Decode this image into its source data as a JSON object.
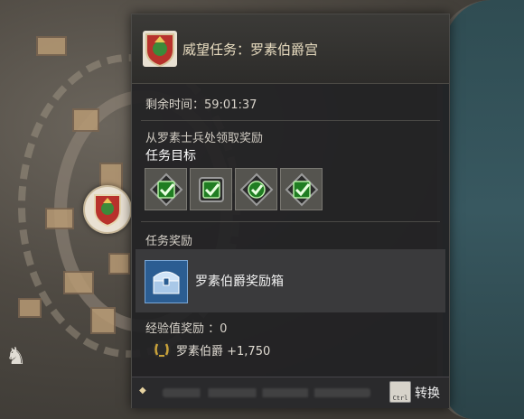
{
  "quest": {
    "title": "威望任务：罗素伯爵宫",
    "remaining_time": "剩余时间：59:01:37",
    "description": "从罗素士兵处领取奖励",
    "objective_label": "任务目标",
    "objectives_completed": 4,
    "reward_label": "任务奖励",
    "reward_item": "罗素伯爵奖励箱",
    "exp_reward": "经验值奖励 ：0",
    "fame_reward": "罗素伯爵 +1,750"
  },
  "footer": {
    "ctrl_key": "Ctrl",
    "switch_label": "转换"
  },
  "colors": {
    "panel_bg": "#212124",
    "title_text": "#e8dcc0",
    "check_green": "#3ed13a",
    "chest_blue": "#2b5d92",
    "laurel_gold": "#c9a23a"
  }
}
